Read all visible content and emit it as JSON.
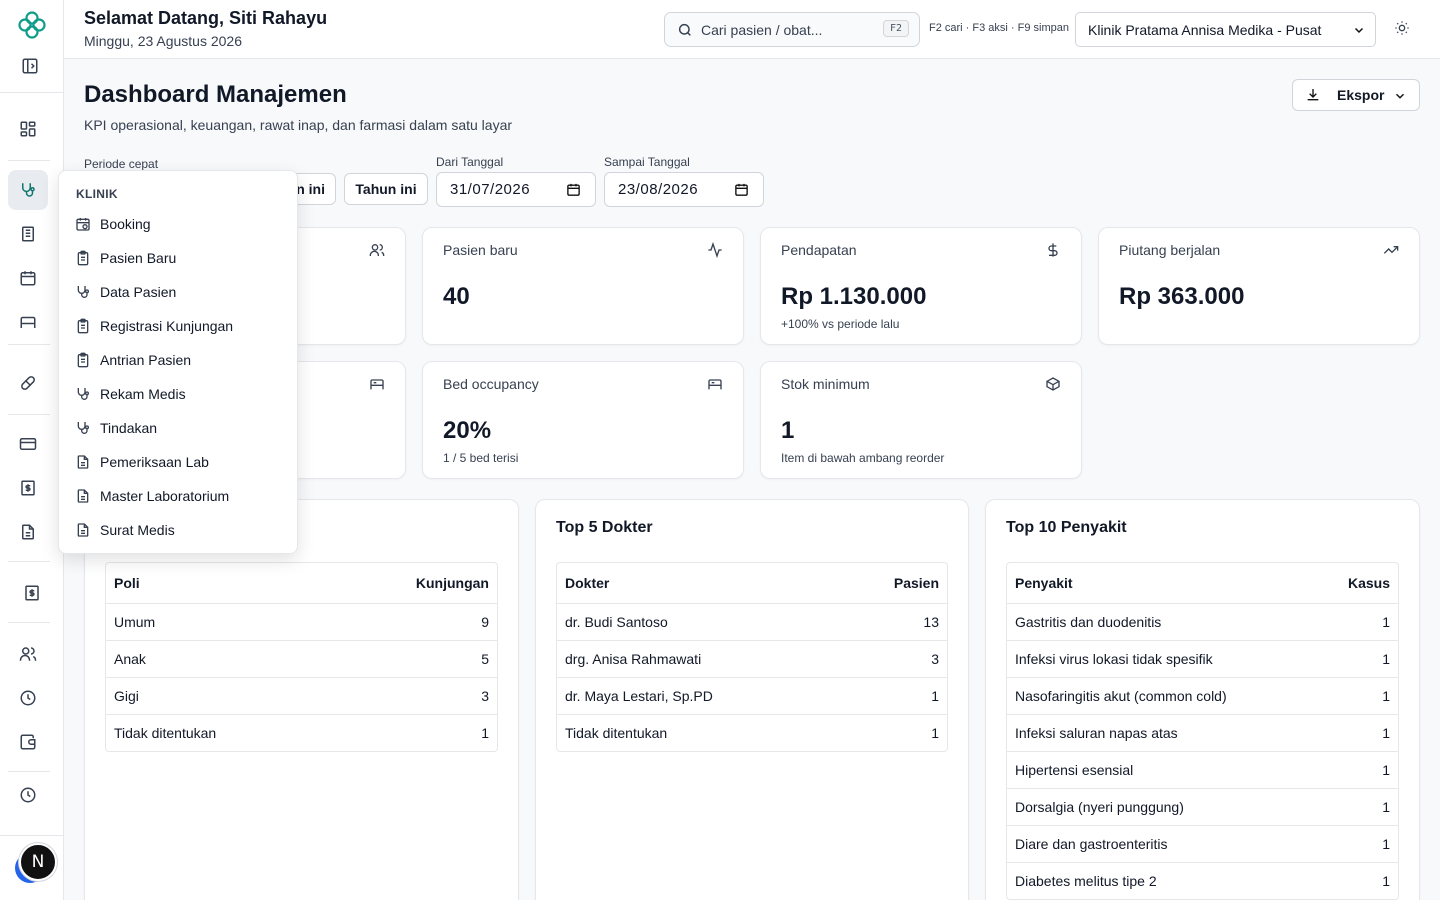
{
  "header": {
    "greeting": "Selamat Datang, Siti Rahayu",
    "date": "Minggu, 23 Agustus 2026",
    "search_placeholder": "Cari pasien / obat...",
    "search_shortcut": "F2",
    "shortcut_hint": "F2 cari · F3 aksi · F9 simpan",
    "clinic": "Klinik Pratama Annisa Medika - Pusat"
  },
  "page": {
    "title": "Dashboard Manajemen",
    "subtitle": "KPI operasional, keuangan, rawat inap, dan farmasi dalam satu layar",
    "export_label": "Ekspor"
  },
  "filters": {
    "quick_label": "Periode cepat",
    "quick_partial": "an ini",
    "year_button": "Tahun ini",
    "from_label": "Dari Tanggal",
    "from_value": "31/07/2026",
    "to_label": "Sampai Tanggal",
    "to_value": "23/08/2026"
  },
  "kpis": [
    {
      "label": "Pasien baru",
      "value": "40",
      "sub": "",
      "icon": "activity-icon"
    },
    {
      "label": "Pendapatan",
      "value": "Rp 1.130.000",
      "sub": "+100% vs periode lalu",
      "icon": "dollar-icon"
    },
    {
      "label": "Piutang berjalan",
      "value": "Rp 363.000",
      "sub": "",
      "icon": "trending-up-icon"
    },
    {
      "label": "Bed occupancy",
      "value": "20%",
      "sub": "1 / 5 bed terisi",
      "icon": "bed-icon"
    },
    {
      "label": "Stok minimum",
      "value": "1",
      "sub": "Item di bawah ambang reorder",
      "icon": "package-icon"
    }
  ],
  "poli_table": {
    "headers": [
      "Poli",
      "Kunjungan"
    ],
    "rows": [
      [
        "Umum",
        "9"
      ],
      [
        "Anak",
        "5"
      ],
      [
        "Gigi",
        "3"
      ],
      [
        "Tidak ditentukan",
        "1"
      ]
    ]
  },
  "dokter_panel": {
    "title": "Top 5 Dokter",
    "headers": [
      "Dokter",
      "Pasien"
    ],
    "rows": [
      [
        "dr. Budi Santoso",
        "13"
      ],
      [
        "drg. Anisa Rahmawati",
        "3"
      ],
      [
        "dr. Maya Lestari, Sp.PD",
        "1"
      ],
      [
        "Tidak ditentukan",
        "1"
      ]
    ]
  },
  "penyakit_panel": {
    "title": "Top 10 Penyakit",
    "headers": [
      "Penyakit",
      "Kasus"
    ],
    "rows": [
      [
        "Gastritis dan duodenitis",
        "1"
      ],
      [
        "Infeksi virus lokasi tidak spesifik",
        "1"
      ],
      [
        "Nasofaringitis akut (common cold)",
        "1"
      ],
      [
        "Infeksi saluran napas atas",
        "1"
      ],
      [
        "Hipertensi esensial",
        "1"
      ],
      [
        "Dorsalgia (nyeri punggung)",
        "1"
      ],
      [
        "Diare dan gastroenteritis",
        "1"
      ],
      [
        "Diabetes melitus tipe 2",
        "1"
      ]
    ]
  },
  "menu": {
    "heading": "KLINIK",
    "items": [
      {
        "label": "Booking",
        "icon": "calendar-clock-icon"
      },
      {
        "label": "Pasien Baru",
        "icon": "clipboard-icon"
      },
      {
        "label": "Data Pasien",
        "icon": "stethoscope-icon"
      },
      {
        "label": "Registrasi Kunjungan",
        "icon": "clipboard-icon"
      },
      {
        "label": "Antrian Pasien",
        "icon": "clipboard-icon"
      },
      {
        "label": "Rekam Medis",
        "icon": "stethoscope-icon"
      },
      {
        "label": "Tindakan",
        "icon": "stethoscope-icon"
      },
      {
        "label": "Pemeriksaan Lab",
        "icon": "file-text-icon"
      },
      {
        "label": "Master Laboratorium",
        "icon": "file-text-icon"
      },
      {
        "label": "Surat Medis",
        "icon": "file-text-icon"
      }
    ]
  },
  "user": {
    "initial": "N"
  },
  "colors": {
    "brand": "#0f9d8a",
    "accent": "#2563eb"
  }
}
